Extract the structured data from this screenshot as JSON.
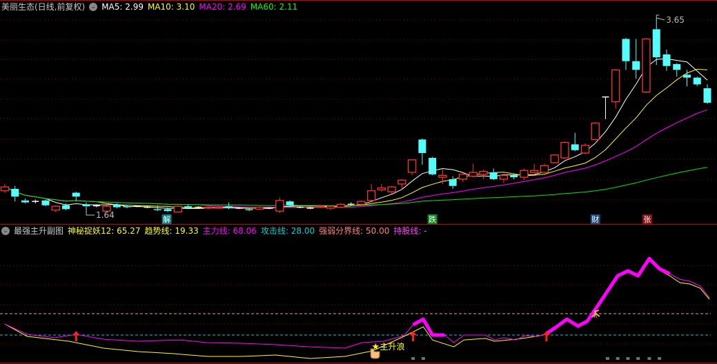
{
  "main_header": {
    "title": "美丽生态(日线,前复权)",
    "ma5": "MA5: 2.99",
    "ma10": "MA10: 3.10",
    "ma20": "MA20: 2.69",
    "ma60": "MA60: 2.11"
  },
  "sub_header": {
    "title": "最强主升副图",
    "l1": "神秘捉妖12: 65.27",
    "l2": "趋势线: 19.33",
    "l3": "主力线: 68.06",
    "l4": "攻击线: 28.00",
    "l5": "强弱分界线: 50.00",
    "l6": "持股线: -"
  },
  "colors": {
    "up": "#ff3232",
    "down": "#54fcfc",
    "ma5": "#ffffff",
    "ma10": "#ffff00",
    "ma20": "#ff00ff",
    "ma60": "#00e600"
  },
  "chart_data": [
    {
      "type": "candlestick",
      "title": "美丽生态(日线,前复权)",
      "ylim": [
        1.64,
        3.65
      ],
      "ohlc_order": "open,high,low,close",
      "candles": [
        [
          1.87,
          1.94,
          1.85,
          1.91
        ],
        [
          1.89,
          1.92,
          1.76,
          1.81
        ],
        [
          1.77,
          1.79,
          1.74,
          1.75
        ],
        [
          1.76,
          1.78,
          1.74,
          1.76
        ],
        [
          1.77,
          1.78,
          1.71,
          1.72
        ],
        [
          1.67,
          1.72,
          1.65,
          1.71
        ],
        [
          1.72,
          1.74,
          1.67,
          1.68
        ],
        [
          1.85,
          1.86,
          1.76,
          1.81
        ],
        [
          1.73,
          1.75,
          1.64,
          1.71
        ],
        [
          1.715,
          1.73,
          1.7,
          1.715
        ],
        [
          1.66,
          1.72,
          1.65,
          1.71
        ],
        [
          1.73,
          1.74,
          1.69,
          1.7
        ],
        [
          1.71,
          1.72,
          1.69,
          1.7
        ],
        [
          1.71,
          1.72,
          1.7,
          1.71
        ],
        [
          1.7,
          1.71,
          1.69,
          1.7
        ],
        [
          1.68,
          1.72,
          1.66,
          1.67
        ],
        [
          1.68,
          1.7,
          1.65,
          1.66
        ],
        [
          1.65,
          1.72,
          1.65,
          1.71
        ],
        [
          1.71,
          1.73,
          1.68,
          1.69
        ],
        [
          1.7,
          1.71,
          1.69,
          1.7
        ],
        [
          1.69,
          1.71,
          1.68,
          1.7
        ],
        [
          1.69,
          1.71,
          1.68,
          1.7
        ],
        [
          1.71,
          1.75,
          1.68,
          1.69
        ],
        [
          1.69,
          1.7,
          1.68,
          1.69
        ],
        [
          1.68,
          1.69,
          1.66,
          1.67
        ],
        [
          1.68,
          1.71,
          1.67,
          1.7
        ],
        [
          1.69,
          1.7,
          1.68,
          1.69
        ],
        [
          1.66,
          1.8,
          1.64,
          1.77
        ],
        [
          1.76,
          1.77,
          1.7,
          1.72
        ],
        [
          1.7,
          1.71,
          1.69,
          1.7
        ],
        [
          1.69,
          1.7,
          1.68,
          1.69
        ],
        [
          1.7,
          1.72,
          1.69,
          1.71
        ],
        [
          1.69,
          1.72,
          1.67,
          1.71
        ],
        [
          1.7,
          1.74,
          1.69,
          1.73
        ],
        [
          1.73,
          1.75,
          1.72,
          1.73
        ],
        [
          1.73,
          1.77,
          1.72,
          1.76
        ],
        [
          1.77,
          1.94,
          1.76,
          1.87
        ],
        [
          1.88,
          1.94,
          1.86,
          1.9
        ],
        [
          1.86,
          1.92,
          1.84,
          1.91
        ],
        [
          1.94,
          1.99,
          1.88,
          1.98
        ],
        [
          2.06,
          2.19,
          2.03,
          2.19
        ],
        [
          2.4,
          2.41,
          2.14,
          2.26
        ],
        [
          2.21,
          2.22,
          2.03,
          2.04
        ],
        [
          2.01,
          2.09,
          1.94,
          2.03
        ],
        [
          1.99,
          2.02,
          1.89,
          1.92
        ],
        [
          1.99,
          2.05,
          1.96,
          2.04
        ],
        [
          2.02,
          2.15,
          2.01,
          2.06
        ],
        [
          2.04,
          2.09,
          1.99,
          2.07
        ],
        [
          2.06,
          2.1,
          1.98,
          1.99
        ],
        [
          1.99,
          2.04,
          1.95,
          2.03
        ],
        [
          2.03,
          2.05,
          1.99,
          2.01
        ],
        [
          2.01,
          2.1,
          1.98,
          2.08
        ],
        [
          2.06,
          2.15,
          2.05,
          2.08
        ],
        [
          2.06,
          2.15,
          2.05,
          2.13
        ],
        [
          2.16,
          2.25,
          2.15,
          2.24
        ],
        [
          2.21,
          2.38,
          2.2,
          2.37
        ],
        [
          2.35,
          2.47,
          2.28,
          2.29
        ],
        [
          2.26,
          2.36,
          2.25,
          2.34
        ],
        [
          2.4,
          2.58,
          2.39,
          2.57
        ],
        [
          2.84,
          2.84,
          2.61,
          2.84
        ],
        [
          2.79,
          3.13,
          2.72,
          3.12
        ],
        [
          3.44,
          3.45,
          3.12,
          3.21
        ],
        [
          3.21,
          3.44,
          3.03,
          3.12
        ],
        [
          2.89,
          3.45,
          2.88,
          3.44
        ],
        [
          3.54,
          3.65,
          3.17,
          3.25
        ],
        [
          3.28,
          3.33,
          3.11,
          3.16
        ],
        [
          3.18,
          3.19,
          3.05,
          3.12
        ],
        [
          3.07,
          3.12,
          2.95,
          3.04
        ],
        [
          3.04,
          3.05,
          2.95,
          2.97
        ],
        [
          2.93,
          2.97,
          2.77,
          2.78
        ]
      ],
      "moving_averages": [
        5,
        10,
        20,
        60
      ],
      "annotations": {
        "high_label": {
          "index": 64,
          "text": "3.65"
        },
        "low_label": {
          "index": 8,
          "text": "1.64"
        },
        "tags": [
          {
            "index": 15.9,
            "text": "解",
            "color": "#008080"
          },
          {
            "index": 42,
            "text": "跌",
            "color": "#0a8a1a"
          },
          {
            "index": 58,
            "text": "财",
            "color": "#1a4a7a"
          },
          {
            "index": 63.1,
            "text": "张",
            "color": "#8a1010"
          }
        ]
      }
    },
    {
      "type": "line",
      "title": "最强主升副图",
      "reference_lines": [
        {
          "value": 50,
          "color": "#ff9a9a"
        },
        {
          "value": 28,
          "color": "#00d0d0"
        }
      ],
      "series": [
        {
          "name": "主力线",
          "color": "#ff00ff",
          "points": [
            [
              0,
              39.3
            ],
            [
              2.2,
              28.7
            ],
            [
              4.9,
              25.2
            ],
            [
              7,
              28.7
            ],
            [
              9.7,
              23.7
            ],
            [
              13.1,
              21.6
            ],
            [
              17.2,
              23
            ],
            [
              19.9,
              20.2
            ],
            [
              23.3,
              19.5
            ],
            [
              26.6,
              18.1
            ],
            [
              30,
              15.9
            ],
            [
              33.4,
              14.5
            ],
            [
              35.1,
              20.2
            ],
            [
              37.2,
              21.6
            ],
            [
              39.2,
              27.3
            ],
            [
              40.1,
              38.6
            ],
            [
              41.1,
              44.3
            ],
            [
              42,
              28
            ],
            [
              43.2,
              28
            ],
            [
              44.1,
              20.2
            ],
            [
              45.1,
              28
            ],
            [
              47.2,
              28
            ],
            [
              48.1,
              23
            ],
            [
              49,
              25.2
            ],
            [
              50.2,
              23
            ],
            [
              51.1,
              27.3
            ],
            [
              52.3,
              26.6
            ],
            [
              53.2,
              29.4
            ],
            [
              54.2,
              36.5
            ],
            [
              55.2,
              44.3
            ],
            [
              56.3,
              37.2
            ],
            [
              57.2,
              42.2
            ],
            [
              58.4,
              60.6
            ],
            [
              60.2,
              89
            ],
            [
              61.2,
              94
            ],
            [
              62.2,
              89
            ],
            [
              63.3,
              106.7
            ],
            [
              64.3,
              96.1
            ],
            [
              65.3,
              91.1
            ],
            [
              66.3,
              85.4
            ],
            [
              67.3,
              83.3
            ],
            [
              68.3,
              78.4
            ],
            [
              69.2,
              66.3
            ]
          ],
          "thick_ranges": [
            [
              40,
              43.2
            ],
            [
              53.2,
              65.3
            ]
          ]
        },
        {
          "name": "神秘捉妖12",
          "color": "#ffff00",
          "points": [
            [
              0,
              39.3
            ],
            [
              2.2,
              26.6
            ],
            [
              6.3,
              21.6
            ],
            [
              9.7,
              14.5
            ],
            [
              13.1,
              11
            ],
            [
              16.5,
              8.9
            ],
            [
              19.9,
              6
            ],
            [
              23.3,
              6
            ],
            [
              26.6,
              7.4
            ],
            [
              30,
              3.9
            ],
            [
              33.4,
              6
            ],
            [
              36.1,
              11.7
            ],
            [
              39.2,
              26.6
            ],
            [
              41.1,
              36.5
            ],
            [
              42,
              23
            ],
            [
              44.1,
              15.9
            ],
            [
              45.1,
              23
            ],
            [
              47.2,
              24.5
            ],
            [
              48.1,
              21.6
            ],
            [
              50.2,
              23.7
            ],
            [
              51.7,
              25.9
            ],
            [
              53.2,
              28.7
            ],
            [
              54.2,
              36.5
            ],
            [
              55.2,
              42.9
            ],
            [
              56.3,
              36.5
            ],
            [
              57.2,
              41.5
            ],
            [
              58.4,
              59.2
            ],
            [
              60.2,
              87.6
            ],
            [
              61.2,
              92.5
            ],
            [
              62.2,
              87.6
            ],
            [
              63.3,
              104.6
            ],
            [
              64.3,
              94.7
            ],
            [
              65.3,
              89
            ],
            [
              66.3,
              81.9
            ],
            [
              67.3,
              80.5
            ],
            [
              68.3,
              76.2
            ],
            [
              69.2,
              64.9
            ]
          ]
        }
      ],
      "signals": {
        "up_arrows": [
          7,
          40.1,
          53.2
        ],
        "star_label": {
          "index": 36.5,
          "text": "主升浪"
        },
        "hand_index": 36.2,
        "runner_index": 58,
        "gray_blocks": [
          40.1,
          41.1,
          59.2,
          60.2,
          61.2,
          62.2,
          63.3,
          64.3
        ]
      }
    }
  ]
}
